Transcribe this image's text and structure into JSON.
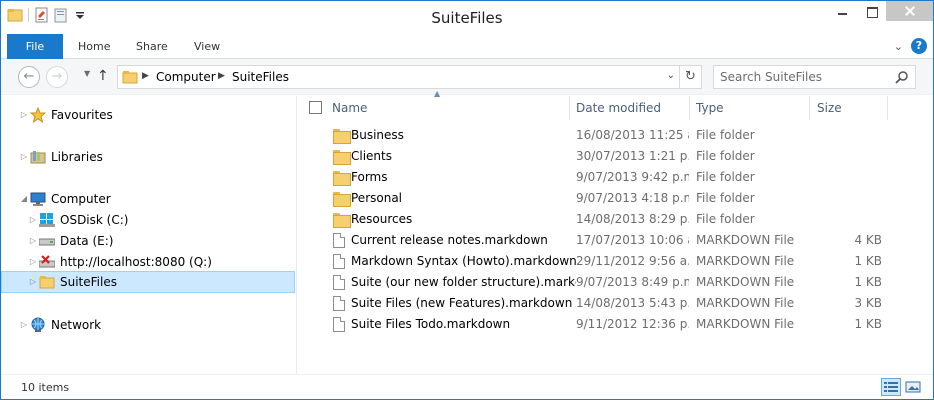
{
  "window": {
    "title": "SuiteFiles"
  },
  "quick_access": {
    "icons": [
      "folder-icon",
      "properties-icon",
      "new-folder-icon",
      "customize-dropdown-icon"
    ]
  },
  "ribbon": {
    "file_label": "File",
    "tabs": [
      "Home",
      "Share",
      "View"
    ]
  },
  "navigation": {
    "back_icon": "back-arrow-icon",
    "forward_icon": "forward-arrow-icon",
    "up_icon": "up-arrow-icon",
    "breadcrumbs": [
      "Computer",
      "SuiteFiles"
    ],
    "search_placeholder": "Search SuiteFiles"
  },
  "nav_pane": {
    "items": [
      {
        "label": "Favourites",
        "icon": "star-icon",
        "level": 0
      },
      {
        "label": "Libraries",
        "icon": "libraries-icon",
        "level": 0
      },
      {
        "label": "Computer",
        "icon": "computer-icon",
        "level": 0,
        "expanded": true
      },
      {
        "label": "OSDisk (C:)",
        "icon": "windows-drive-icon",
        "level": 1
      },
      {
        "label": "Data (E:)",
        "icon": "drive-icon",
        "level": 1
      },
      {
        "label": "http://localhost:8080 (Q:)",
        "icon": "disconnected-drive-icon",
        "level": 1
      },
      {
        "label": "SuiteFiles",
        "icon": "folder-icon",
        "level": 1,
        "selected": true
      },
      {
        "label": "Network",
        "icon": "network-icon",
        "level": 0
      }
    ]
  },
  "file_list": {
    "columns": [
      "Name",
      "Date modified",
      "Type",
      "Size"
    ],
    "rows": [
      {
        "name": "Business",
        "date": "16/08/2013 11:25 a...",
        "type": "File folder",
        "size": "",
        "icon": "folder-icon"
      },
      {
        "name": "Clients",
        "date": "30/07/2013 1:21 p....",
        "type": "File folder",
        "size": "",
        "icon": "folder-icon"
      },
      {
        "name": "Forms",
        "date": "9/07/2013 9:42 p.m.",
        "type": "File folder",
        "size": "",
        "icon": "folder-icon"
      },
      {
        "name": "Personal",
        "date": "9/07/2013 4:18 p.m.",
        "type": "File folder",
        "size": "",
        "icon": "folder-icon"
      },
      {
        "name": "Resources",
        "date": "14/08/2013 8:29 p....",
        "type": "File folder",
        "size": "",
        "icon": "folder-icon"
      },
      {
        "name": "Current release notes.markdown",
        "date": "17/07/2013 10:06 a...",
        "type": "MARKDOWN File",
        "size": "4 KB",
        "icon": "document-icon"
      },
      {
        "name": "Markdown Syntax (Howto).markdown",
        "date": "29/11/2012 9:56 a....",
        "type": "MARKDOWN File",
        "size": "1 KB",
        "icon": "document-icon"
      },
      {
        "name": "Suite (our new folder structure).markd...",
        "date": "9/07/2013 8:49 p.m.",
        "type": "MARKDOWN File",
        "size": "1 KB",
        "icon": "document-icon"
      },
      {
        "name": "Suite Files (new Features).markdown",
        "date": "14/08/2013 5:43 p....",
        "type": "MARKDOWN File",
        "size": "3 KB",
        "icon": "document-icon"
      },
      {
        "name": "Suite Files Todo.markdown",
        "date": "9/11/2012 12:36 p....",
        "type": "MARKDOWN File",
        "size": "1 KB",
        "icon": "document-icon"
      }
    ]
  },
  "status": {
    "item_count": "10 items"
  },
  "colors": {
    "accent": "#1979ca",
    "selection": "#cce8ff",
    "header_text": "#4c607a",
    "meta_text": "#6d6d6d"
  }
}
